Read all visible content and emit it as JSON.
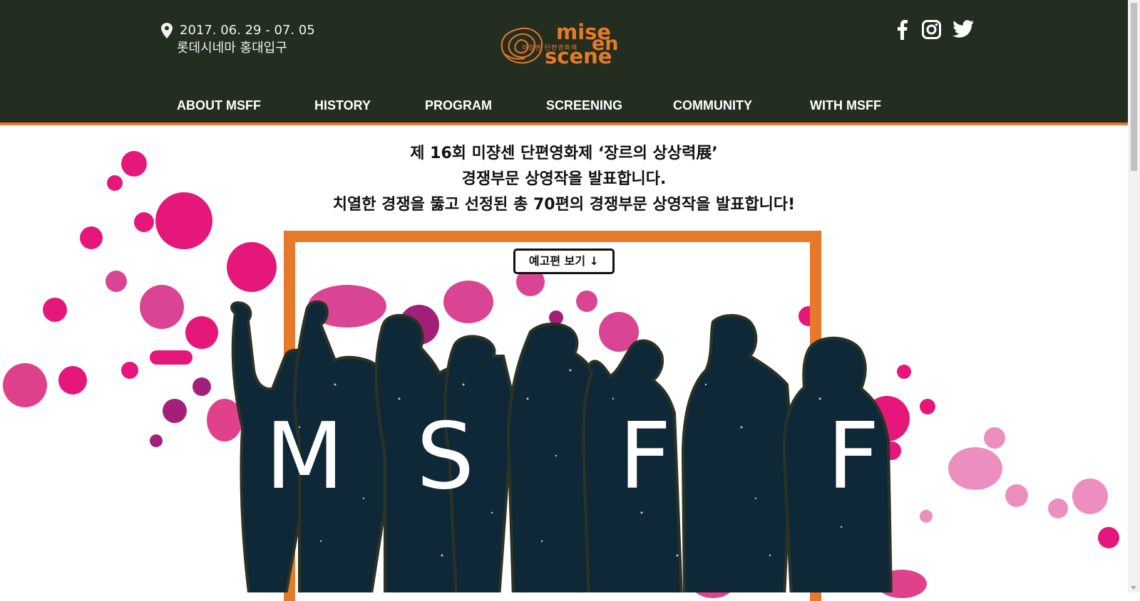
{
  "header": {
    "dates": "2017. 06. 29 - 07. 05",
    "venue": "롯데시네마 홍대입구",
    "logo": {
      "word_mise": "mise",
      "word_en": "en",
      "word_scene": "scene",
      "subtitle": "미장센 단편영화제"
    },
    "social": [
      "facebook-icon",
      "instagram-icon",
      "twitter-icon"
    ]
  },
  "nav": {
    "items": [
      "ABOUT MSFF",
      "HISTORY",
      "PROGRAM",
      "SCREENING",
      "COMMUNITY",
      "WITH MSFF"
    ]
  },
  "hero": {
    "headline_line1": "제 16회 미쟝센 단편영화제 ‘장르의 상상력展’",
    "headline_line2": "경쟁부문 상영작을 발표합니다.",
    "headline_line3": "치열한 경쟁을 뚫고 선정된 총 70편의 경쟁부문 상영작을 발표합니다!",
    "trailer_button": "예고편 보기 ↓",
    "msff_letters": [
      "M",
      "S",
      "F",
      "F"
    ]
  },
  "colors": {
    "header_bg": "#232d20",
    "accent_orange": "#e77a2a",
    "splatter_pink": "#e6177a",
    "splatter_purple": "#a3207a",
    "silhouette_navy": "#0f2838"
  }
}
